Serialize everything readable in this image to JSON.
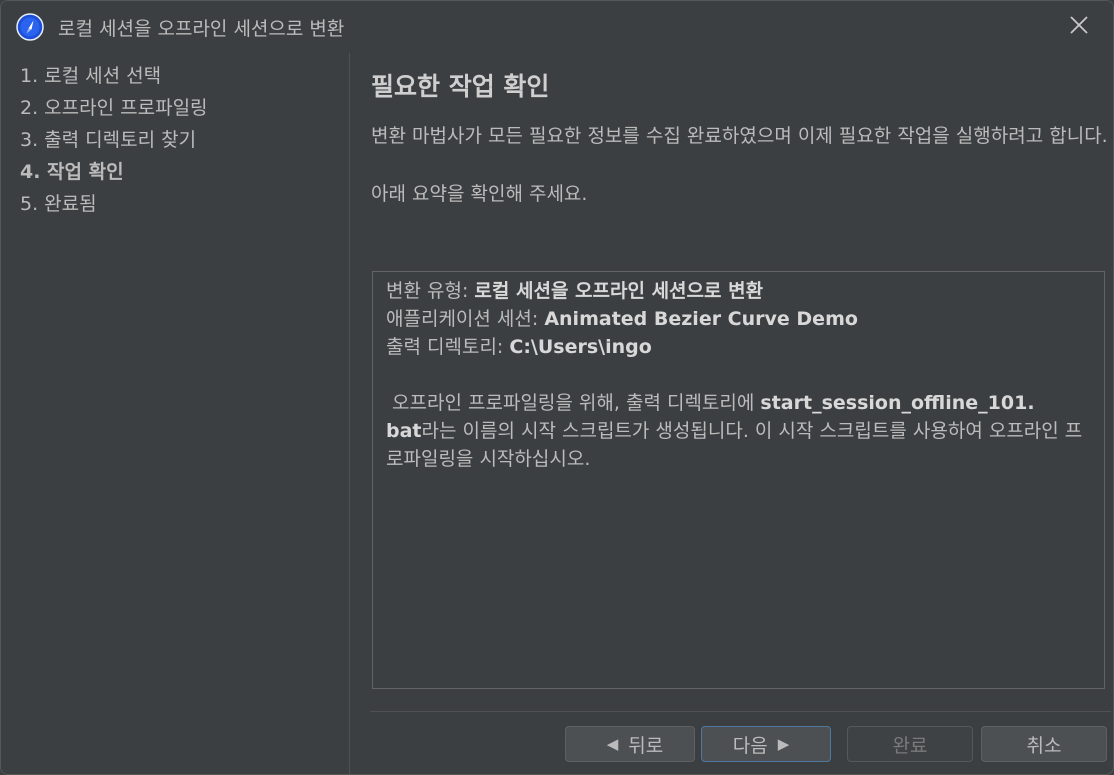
{
  "window": {
    "title": "로컬 세션을 오프라인 세션으로 변환",
    "icon": "compass-icon",
    "close_icon": "close-icon"
  },
  "steps": [
    {
      "label": "1. 로컬 세션 선택",
      "active": false
    },
    {
      "label": "2. 오프라인 프로파일링",
      "active": false
    },
    {
      "label": "3. 출력 디렉토리 찾기",
      "active": false
    },
    {
      "label": "4. 작업 확인",
      "active": true
    },
    {
      "label": "5. 완료됨",
      "active": false
    }
  ],
  "main": {
    "title": "필요한 작업 확인",
    "description_1": "변환 마법사가 모든 필요한 정보를 수집 완료하였으며 이제 필요한 작업을 실행하려고 합니다.",
    "description_2": "아래 요약을 확인해 주세요."
  },
  "summary": {
    "conversion_type_label": "변환 유형: ",
    "conversion_type_value": "로컬 세션을 오프라인 세션으로 변환",
    "app_session_label": "애플리케이션 세션: ",
    "app_session_value": "Animated Bezier Curve Demo",
    "output_dir_label": "출력 디렉토리: ",
    "output_dir_value": "C:\\Users\\ingo",
    "note_prefix": " 오프라인 프로파일링을 위해, 출력 디렉토리에 ",
    "note_script_part1": "start_session_offline_101.",
    "note_script_part2": "bat",
    "note_suffix": "라는 이름의 시작 스크립트가 생성됩니다. 이 시작 스크립트를 사용하여 오프라인 프로파일링을 시작하십시오."
  },
  "buttons": {
    "back": "뒤로",
    "next": "다음",
    "finish": "완료",
    "cancel": "취소"
  },
  "colors": {
    "background": "#3c3f41",
    "text": "#bbbbbb",
    "accent": "#4f78a0"
  }
}
